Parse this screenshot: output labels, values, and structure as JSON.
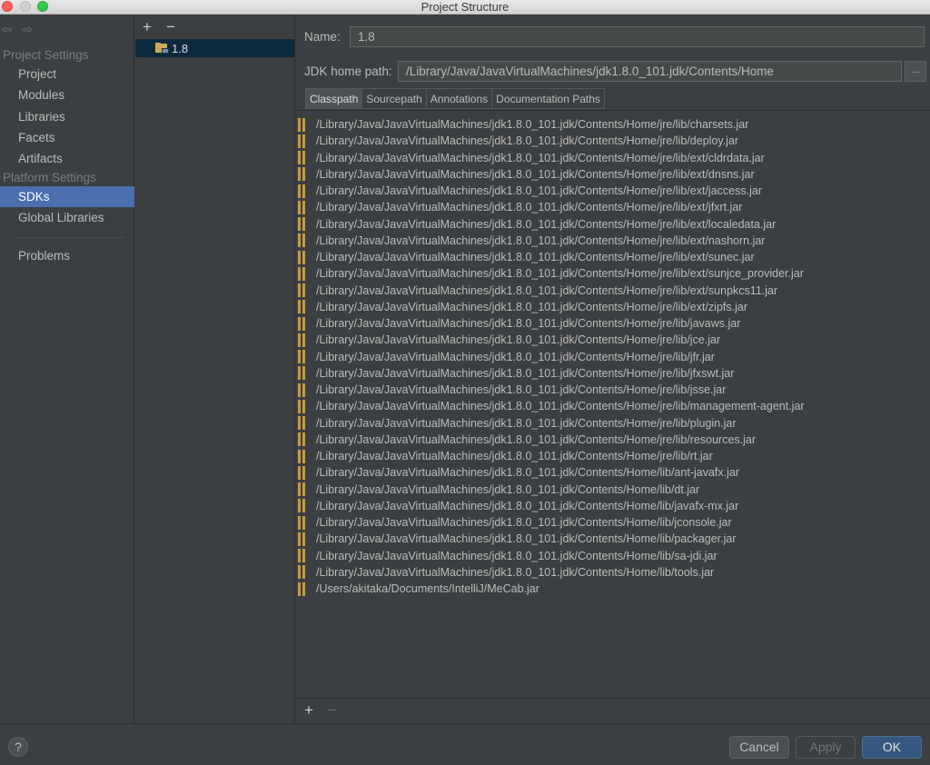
{
  "window": {
    "title": "Project Structure"
  },
  "nav": {
    "project_settings_header": "Project Settings",
    "platform_settings_header": "Platform Settings",
    "items_project": [
      {
        "label": "Project"
      },
      {
        "label": "Modules"
      },
      {
        "label": "Libraries"
      },
      {
        "label": "Facets"
      },
      {
        "label": "Artifacts"
      }
    ],
    "items_platform": [
      {
        "label": "SDKs",
        "selected": true
      },
      {
        "label": "Global Libraries"
      }
    ],
    "problems_label": "Problems"
  },
  "sdk_list": {
    "add_label": "+",
    "remove_label": "−",
    "selected": "1.8"
  },
  "sdk_detail": {
    "name_label": "Name:",
    "name_value": "1.8",
    "home_label": "JDK home path:",
    "home_value": "/Library/Java/JavaVirtualMachines/jdk1.8.0_101.jdk/Contents/Home",
    "browse_label": "...",
    "tabs": [
      {
        "label": "Classpath",
        "active": true
      },
      {
        "label": "Sourcepath",
        "active": false
      },
      {
        "label": "Annotations",
        "active": false
      },
      {
        "label": "Documentation Paths",
        "active": false
      }
    ],
    "classpath": [
      "/Library/Java/JavaVirtualMachines/jdk1.8.0_101.jdk/Contents/Home/jre/lib/charsets.jar",
      "/Library/Java/JavaVirtualMachines/jdk1.8.0_101.jdk/Contents/Home/jre/lib/deploy.jar",
      "/Library/Java/JavaVirtualMachines/jdk1.8.0_101.jdk/Contents/Home/jre/lib/ext/cldrdata.jar",
      "/Library/Java/JavaVirtualMachines/jdk1.8.0_101.jdk/Contents/Home/jre/lib/ext/dnsns.jar",
      "/Library/Java/JavaVirtualMachines/jdk1.8.0_101.jdk/Contents/Home/jre/lib/ext/jaccess.jar",
      "/Library/Java/JavaVirtualMachines/jdk1.8.0_101.jdk/Contents/Home/jre/lib/ext/jfxrt.jar",
      "/Library/Java/JavaVirtualMachines/jdk1.8.0_101.jdk/Contents/Home/jre/lib/ext/localedata.jar",
      "/Library/Java/JavaVirtualMachines/jdk1.8.0_101.jdk/Contents/Home/jre/lib/ext/nashorn.jar",
      "/Library/Java/JavaVirtualMachines/jdk1.8.0_101.jdk/Contents/Home/jre/lib/ext/sunec.jar",
      "/Library/Java/JavaVirtualMachines/jdk1.8.0_101.jdk/Contents/Home/jre/lib/ext/sunjce_provider.jar",
      "/Library/Java/JavaVirtualMachines/jdk1.8.0_101.jdk/Contents/Home/jre/lib/ext/sunpkcs11.jar",
      "/Library/Java/JavaVirtualMachines/jdk1.8.0_101.jdk/Contents/Home/jre/lib/ext/zipfs.jar",
      "/Library/Java/JavaVirtualMachines/jdk1.8.0_101.jdk/Contents/Home/jre/lib/javaws.jar",
      "/Library/Java/JavaVirtualMachines/jdk1.8.0_101.jdk/Contents/Home/jre/lib/jce.jar",
      "/Library/Java/JavaVirtualMachines/jdk1.8.0_101.jdk/Contents/Home/jre/lib/jfr.jar",
      "/Library/Java/JavaVirtualMachines/jdk1.8.0_101.jdk/Contents/Home/jre/lib/jfxswt.jar",
      "/Library/Java/JavaVirtualMachines/jdk1.8.0_101.jdk/Contents/Home/jre/lib/jsse.jar",
      "/Library/Java/JavaVirtualMachines/jdk1.8.0_101.jdk/Contents/Home/jre/lib/management-agent.jar",
      "/Library/Java/JavaVirtualMachines/jdk1.8.0_101.jdk/Contents/Home/jre/lib/plugin.jar",
      "/Library/Java/JavaVirtualMachines/jdk1.8.0_101.jdk/Contents/Home/jre/lib/resources.jar",
      "/Library/Java/JavaVirtualMachines/jdk1.8.0_101.jdk/Contents/Home/jre/lib/rt.jar",
      "/Library/Java/JavaVirtualMachines/jdk1.8.0_101.jdk/Contents/Home/lib/ant-javafx.jar",
      "/Library/Java/JavaVirtualMachines/jdk1.8.0_101.jdk/Contents/Home/lib/dt.jar",
      "/Library/Java/JavaVirtualMachines/jdk1.8.0_101.jdk/Contents/Home/lib/javafx-mx.jar",
      "/Library/Java/JavaVirtualMachines/jdk1.8.0_101.jdk/Contents/Home/lib/jconsole.jar",
      "/Library/Java/JavaVirtualMachines/jdk1.8.0_101.jdk/Contents/Home/lib/packager.jar",
      "/Library/Java/JavaVirtualMachines/jdk1.8.0_101.jdk/Contents/Home/lib/sa-jdi.jar",
      "/Library/Java/JavaVirtualMachines/jdk1.8.0_101.jdk/Contents/Home/lib/tools.jar",
      "/Users/akitaka/Documents/IntelliJ/MeCab.jar"
    ],
    "add_label": "+",
    "remove_label": "−"
  },
  "footer": {
    "help_label": "?",
    "cancel_label": "Cancel",
    "apply_label": "Apply",
    "ok_label": "OK"
  },
  "icons": {
    "back": "back-arrow-icon",
    "forward": "forward-arrow-icon",
    "sdk_folder": "sdk-folder-icon",
    "jar": "jar-icon"
  },
  "colors": {
    "background": "#3c3f41",
    "selection": "#4b6eaf",
    "list_selection": "#0d293e",
    "ok_button": "#365880",
    "jar_icon": "#c79b3b"
  }
}
